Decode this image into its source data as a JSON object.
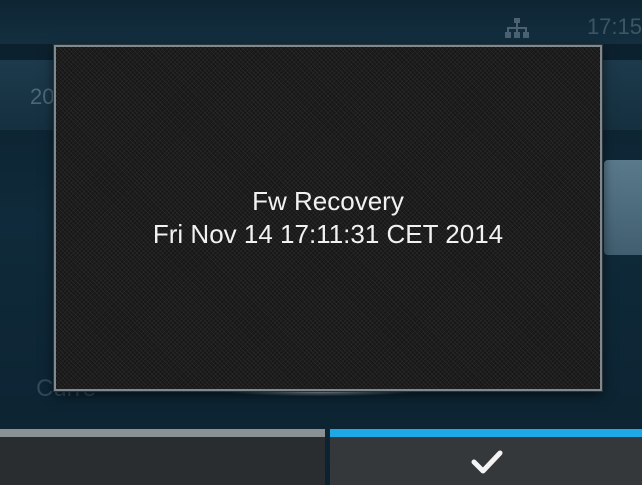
{
  "status_bar": {
    "time": "17:15",
    "network_icon": "network-icon"
  },
  "background": {
    "year_fragment": "20",
    "bottom_label_fragment": "Curre"
  },
  "dialog": {
    "line1": "Fw Recovery",
    "line2": "Fri Nov 14 17:11:31 CET 2014"
  },
  "action_bar": {
    "left_button": "",
    "right_button_icon": "check-icon"
  },
  "colors": {
    "accent": "#1ea8e6",
    "dialog_border": "#7f8a90",
    "text": "#f2f2f2"
  }
}
